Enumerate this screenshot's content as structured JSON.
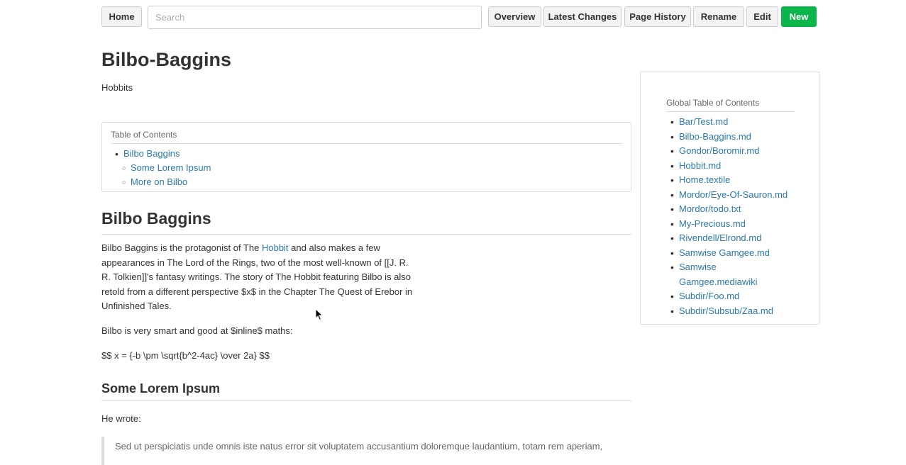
{
  "toolbar": {
    "home_label": "Home",
    "search_placeholder": "Search",
    "overview_label": "Overview",
    "latest_changes_label": "Latest Changes",
    "page_history_label": "Page History",
    "rename_label": "Rename",
    "edit_label": "Edit",
    "new_label": "New"
  },
  "page": {
    "title": "Bilbo-Baggins",
    "subtitle": "Hobbits"
  },
  "toc": {
    "title": "Table of Contents",
    "items": [
      {
        "label": "Bilbo Baggins"
      },
      {
        "label": "Some Lorem Ipsum"
      },
      {
        "label": "More on Bilbo"
      }
    ]
  },
  "content": {
    "heading1": "Bilbo Baggins",
    "para1_before_link": "Bilbo Baggins is the protagonist of The ",
    "para1_link": "Hobbit",
    "para1_after_link": " and also makes a few appearances in The Lord of the Rings, two of the most well-known of [[J. R. R. Tolkien]]'s fantasy writings. The story of The Hobbit featuring Bilbo is also retold from a different perspective $x$ in the Chapter The Quest of Erebor in Unfinished Tales.",
    "para2": "Bilbo is very smart and good at $inline$ maths:",
    "para3": "$$ x = {-b \\pm \\sqrt{b^2-4ac} \\over 2a} $$",
    "heading2": "Some Lorem Ipsum",
    "para4": "He wrote:",
    "quote": "Sed ut perspiciatis unde omnis iste natus error sit voluptatem accusantium doloremque laudantium, totam rem aperiam,"
  },
  "sidebar": {
    "title": "Global Table of Contents",
    "items": [
      {
        "label": "Bar/Test.md"
      },
      {
        "label": "Bilbo-Baggins.md"
      },
      {
        "label": "Gondor/Boromir.md"
      },
      {
        "label": "Hobbit.md"
      },
      {
        "label": "Home.textile"
      },
      {
        "label": "Mordor/Eye-Of-Sauron.md"
      },
      {
        "label": "Mordor/todo.txt"
      },
      {
        "label": "My-Precious.md"
      },
      {
        "label": "Rivendell/Elrond.md"
      },
      {
        "label": "Samwise Gamgee.md"
      },
      {
        "label": "Samwise Gamgee.mediawiki"
      },
      {
        "label": "Subdir/Foo.md"
      },
      {
        "label": "Subdir/Subsub/Zaa.md"
      }
    ]
  },
  "colors": {
    "link": "#2a7ab0",
    "new_button": "#0ab54a"
  }
}
